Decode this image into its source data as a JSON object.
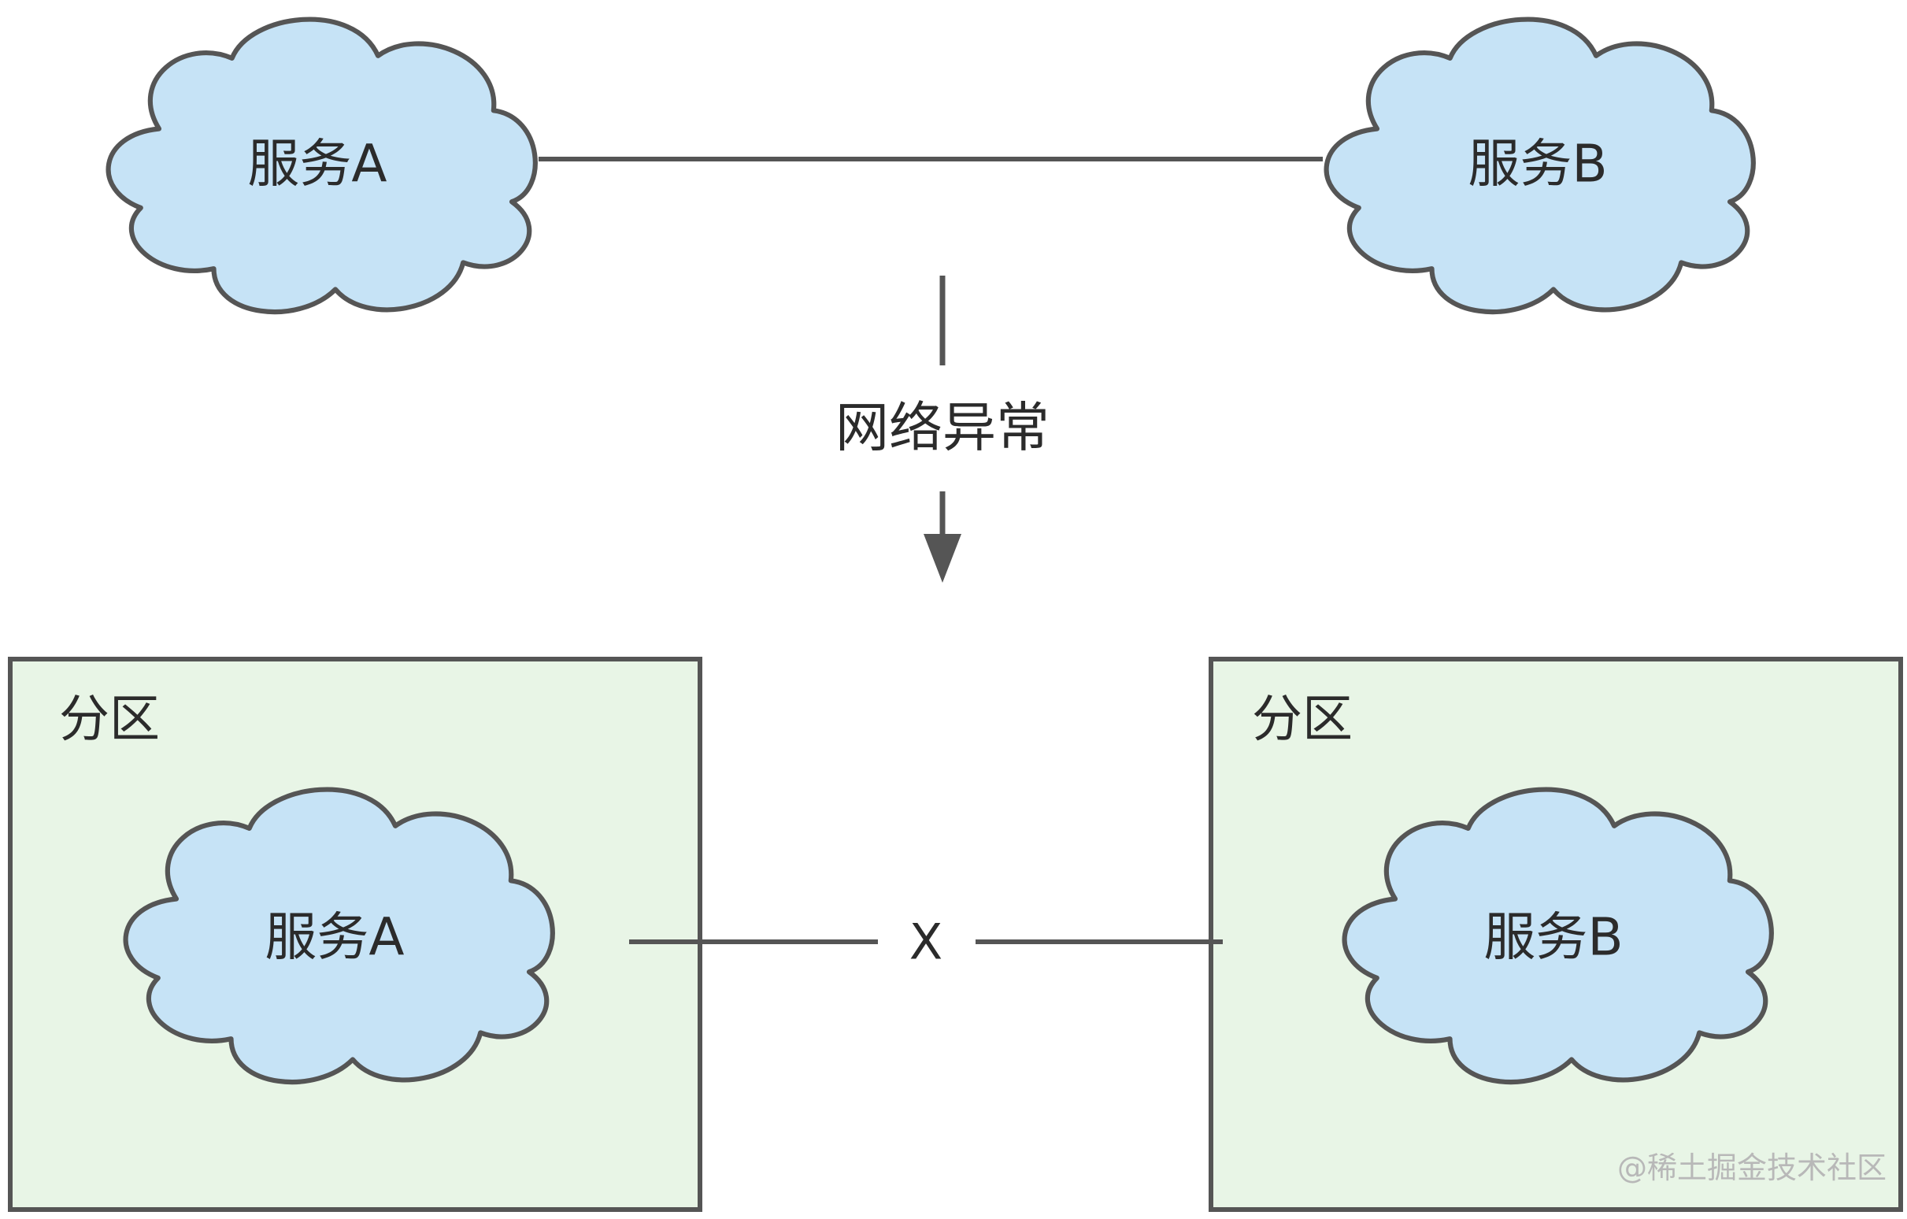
{
  "diagram": {
    "top": {
      "service_a": "服务A",
      "service_b": "服务B"
    },
    "transition_label": "网络异常",
    "bottom": {
      "partition_left": {
        "label": "分区",
        "service": "服务A"
      },
      "partition_right": {
        "label": "分区",
        "service": "服务B"
      },
      "broken_link_label": "X"
    },
    "colors": {
      "cloud_fill": "#c6e3f6",
      "partition_fill": "#e8f5e6",
      "stroke": "#555555"
    }
  },
  "watermark": "@稀土掘金技术社区"
}
